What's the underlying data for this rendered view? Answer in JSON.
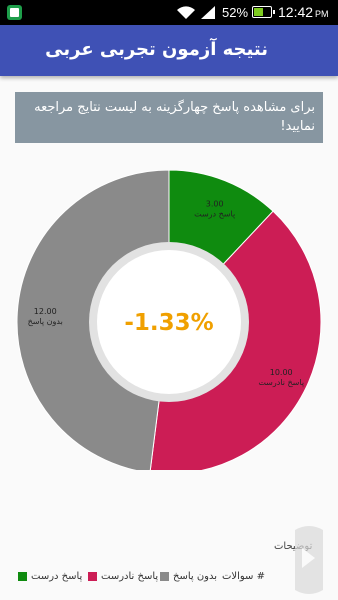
{
  "status_bar": {
    "battery_percent": "52%",
    "time": "12:42",
    "ampm": "PM"
  },
  "app_bar": {
    "title": "نتیجه آزمون تجربی عربی"
  },
  "notice": {
    "text": "برای مشاهده پاسخ چهارگزینه به لیست نتایج مراجعه نمایید!"
  },
  "chart_data": {
    "type": "pie",
    "center_text": "-1.33%",
    "center_color": "#f0a000",
    "slices": [
      {
        "value": 3.0,
        "value_label": "3.00",
        "label": "پاسخ درست",
        "color": "#0f8b0f"
      },
      {
        "value": 10.0,
        "value_label": "10.00",
        "label": "پاسخ نادرست",
        "color": "#cc1d55"
      },
      {
        "value": 12.0,
        "value_label": "12.00",
        "label": "بدون پاسخ",
        "color": "#8a8a8a"
      }
    ]
  },
  "description_label": "توضیحات",
  "legend": {
    "header": "# سوالات",
    "items": [
      {
        "label": "پاسخ درست",
        "color": "#0f8b0f"
      },
      {
        "label": "پاسخ نادرست",
        "color": "#cc1d55"
      },
      {
        "label": "بدون پاسخ",
        "color": "#8a8a8a"
      }
    ]
  },
  "icons": [
    "app-notification-icon",
    "wifi-icon",
    "signal-icon",
    "battery-icon",
    "watermark-logo-icon"
  ]
}
